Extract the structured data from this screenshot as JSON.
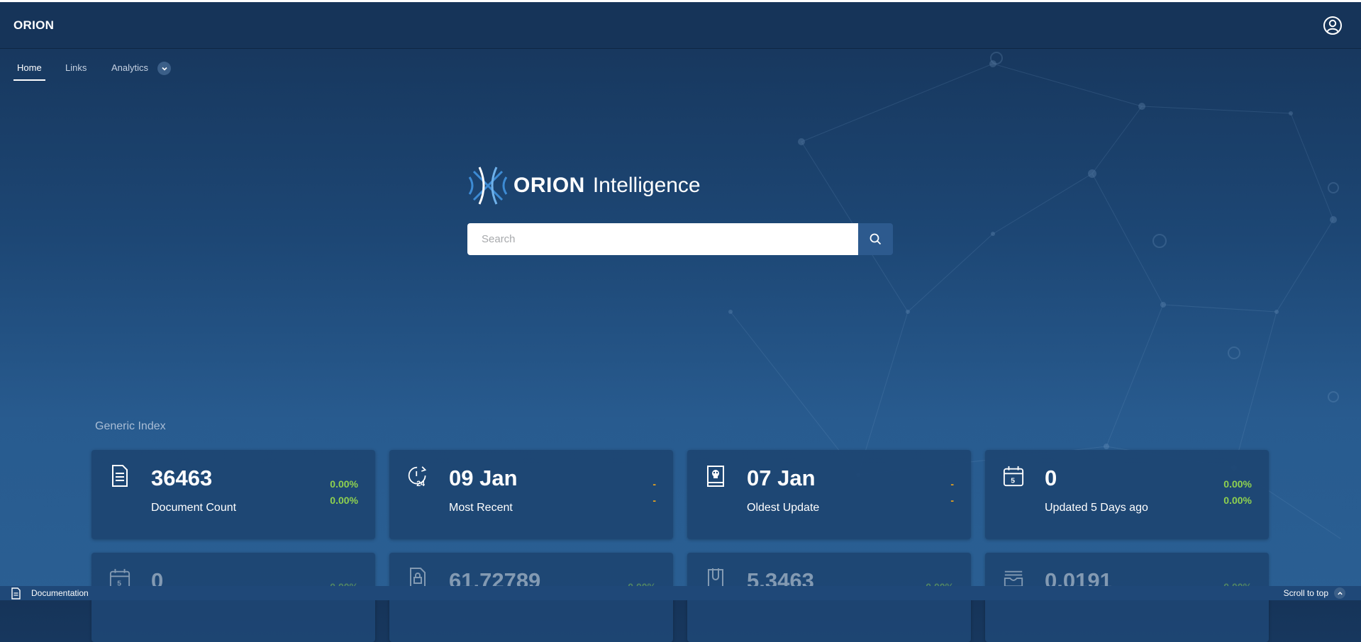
{
  "header": {
    "brand": "ORION",
    "user_icon": "user-circle-icon"
  },
  "nav": {
    "items": [
      {
        "label": "Home",
        "active": true
      },
      {
        "label": "Links",
        "active": false
      },
      {
        "label": "Analytics",
        "active": false
      }
    ],
    "dropdown_icon": "chevron-down-icon"
  },
  "hero": {
    "logo_word": "ORION",
    "logo_suffix": "Intelligence",
    "search_placeholder": "Search",
    "search_icon": "search-icon"
  },
  "section": {
    "title": "Generic Index"
  },
  "cards": [
    {
      "icon": "document-icon",
      "value": "36463",
      "label": "Document Count",
      "delta1": "0.00%",
      "delta2": "0.00%",
      "delta_color": "#8fd14f"
    },
    {
      "icon": "clock-24-icon",
      "value": "09 Jan",
      "label": "Most Recent",
      "delta1": "-",
      "delta2": "-",
      "delta_color": "#f0a71b"
    },
    {
      "icon": "book-skull-icon",
      "value": "07 Jan",
      "label": "Oldest Update",
      "delta1": "-",
      "delta2": "-",
      "delta_color": "#f0a71b"
    },
    {
      "icon": "calendar-5-icon",
      "value": "0",
      "label": "Updated 5 Days ago",
      "delta1": "0.00%",
      "delta2": "0.00%",
      "delta_color": "#8fd14f"
    },
    {
      "icon": "calendar-5-icon",
      "value": "0",
      "delta1": "0.00%"
    },
    {
      "icon": "lock-document-icon",
      "value": "61.72789",
      "delta1": "0.00%"
    },
    {
      "icon": "paperclip-document-icon",
      "value": "5.3463",
      "delta1": "0.00%"
    },
    {
      "icon": "inbox-icon",
      "value": "0.0191",
      "delta1": "0.00%"
    }
  ],
  "footer": {
    "documentation": "Documentation",
    "scroll_to_top": "Scroll to top",
    "doc_icon": "document-icon",
    "scroll_icon": "chevron-up-icon"
  },
  "colors": {
    "background": "#1d4775",
    "accent": "#3d8bd4",
    "positive": "#8fd14f",
    "neutral": "#f0a71b"
  }
}
